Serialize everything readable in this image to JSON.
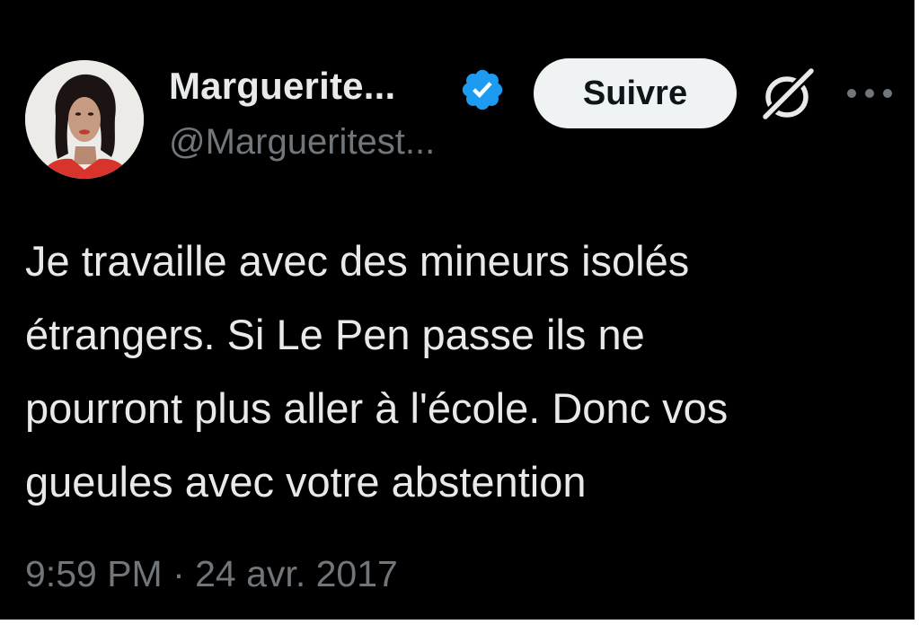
{
  "author": {
    "display_name": "Marguerite...",
    "handle": "@Margueritest...",
    "verified": true,
    "verified_color": "#1d9bf0"
  },
  "actions": {
    "follow_label": "Suivre",
    "grok_icon": "grok-icon",
    "more_icon": "more-icon"
  },
  "tweet": {
    "lines": [
      "Je travaille avec des mineurs isolés",
      "étrangers. Si Le Pen passe ils ne",
      "pourront plus aller à l'école. Donc vos",
      "gueules avec votre abstention"
    ]
  },
  "meta": {
    "timestamp": "9:59 PM · 24 avr. 2017"
  },
  "colors": {
    "background": "#000000",
    "text": "#e7e9ea",
    "secondary_text": "#71767b",
    "follow_button_bg": "#eff3f4"
  }
}
